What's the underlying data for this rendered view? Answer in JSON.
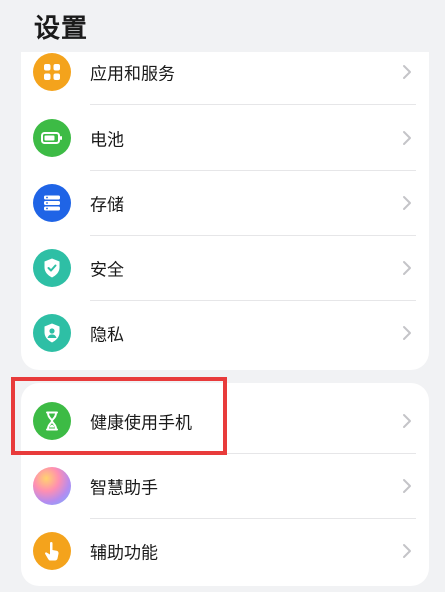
{
  "header": {
    "title": "设置"
  },
  "groups": [
    {
      "items": [
        {
          "label": "应用和服务",
          "icon": "apps-icon",
          "color": "#f4a31c"
        },
        {
          "label": "电池",
          "icon": "battery-icon",
          "color": "#3dbb45"
        },
        {
          "label": "存储",
          "icon": "storage-icon",
          "color": "#1f64e6"
        },
        {
          "label": "安全",
          "icon": "shield-check-icon",
          "color": "#2ebfa5"
        },
        {
          "label": "隐私",
          "icon": "privacy-shield-icon",
          "color": "#2ebfa5"
        }
      ]
    },
    {
      "items": [
        {
          "label": "健康使用手机",
          "icon": "hourglass-icon",
          "color": "#3dbb45"
        },
        {
          "label": "智慧助手",
          "icon": "assistant-orb-icon",
          "color": "#b78bdc"
        },
        {
          "label": "辅助功能",
          "icon": "hand-tap-icon",
          "color": "#f4a31c"
        }
      ]
    }
  ],
  "highlight_color": "#e83b3b"
}
